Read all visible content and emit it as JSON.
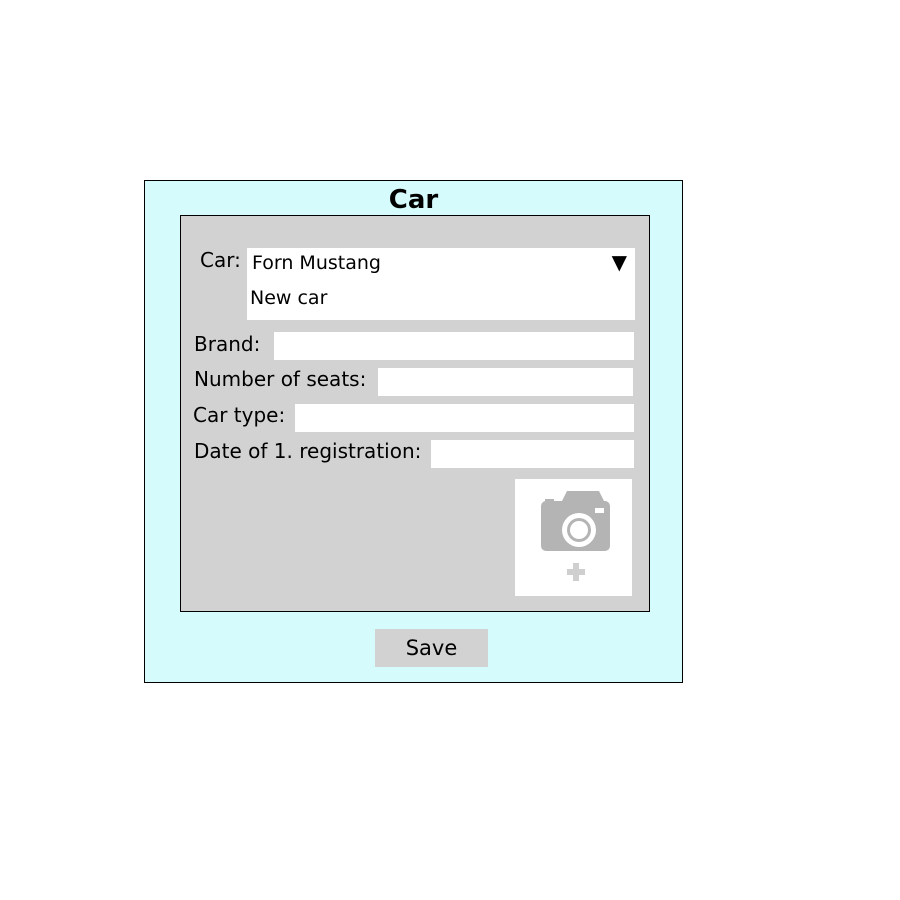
{
  "window": {
    "title": "Car"
  },
  "form": {
    "car_label": "Car:",
    "car_select": {
      "selected": "Forn Mustang",
      "arrow_icon": "triangle-down-icon",
      "options": [
        "New car"
      ]
    },
    "brand_label": "Brand:",
    "brand_value": "",
    "seats_label": "Number of seats:",
    "seats_value": "",
    "type_label": "Car type:",
    "type_value": "",
    "registration_label": "Date of 1. registration:",
    "registration_value": "",
    "photo": {
      "icon": "camera-icon",
      "add_icon": "plus-icon"
    }
  },
  "actions": {
    "save_label": "Save"
  },
  "colors": {
    "window_bg": "#d5fbfc",
    "panel_bg": "#d2d2d2",
    "icon_gray": "#b4b4b4"
  }
}
